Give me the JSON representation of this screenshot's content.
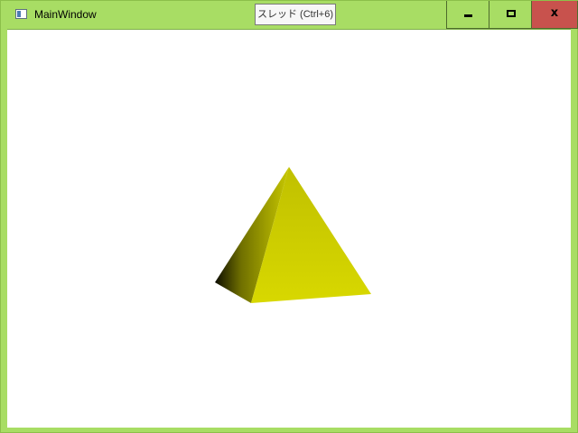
{
  "window": {
    "title": "MainWindow",
    "icon": "window-icon"
  },
  "toolbar": {
    "thread_button_label": "スレッド (Ctrl+6)"
  },
  "caption_buttons": {
    "minimize_icon": "minimize-icon",
    "maximize_icon": "maximize-icon",
    "close_label": "x"
  },
  "viewport": {
    "object": "pyramid",
    "colors": {
      "face_light": "#d6d600",
      "face_mid": "#c4c400",
      "face_dark": "#1a1a00",
      "window_frame": "#a8dd64",
      "close_button": "#c8524d"
    }
  }
}
